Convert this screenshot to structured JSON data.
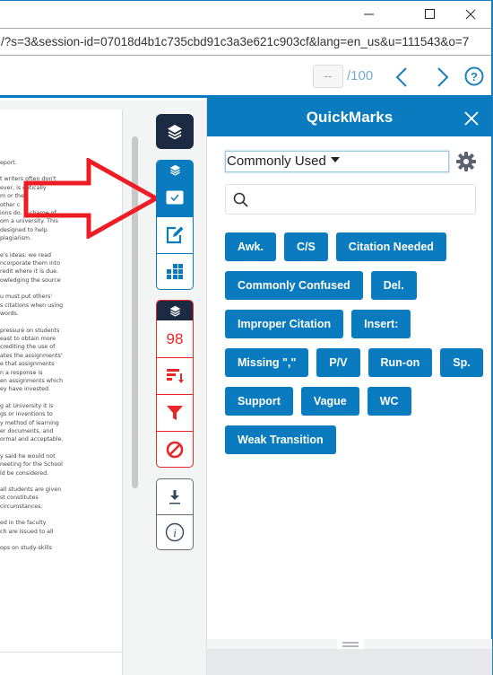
{
  "window": {
    "controls": {
      "minimize": "—",
      "maximize": "☐",
      "close": "✕"
    },
    "url": "/?s=3&session-id=07018d4b1c735cbd91c3a3e621c903cf&lang=en_us&u=111543&o=7"
  },
  "toolbar": {
    "page_input_value": "--",
    "page_total": "/100",
    "prev_icon": "chevron-left-icon",
    "next_icon": "chevron-right-icon",
    "help_icon": "help-circle-icon"
  },
  "document": {
    "paragraphs": [
      [
        "eport."
      ],
      [
        "t writers often don't",
        "ever, is critically",
        "m or the",
        " other c",
        "ions do. A charge of",
        "om a university. This",
        "designed to help",
        " plagiarism."
      ],
      [
        "e's ideas: we read",
        "ncorporate them into",
        "redit where it is due.",
        "owledging the source"
      ],
      [
        "u must put others'",
        "s citations when using",
        "words."
      ],
      [
        "pressure on students",
        "east to obtain more",
        "crediting the use of",
        "ates the assignments'",
        "e that assignments",
        "n a response is",
        "en assignments which",
        "ey have invested."
      ],
      [
        "g at University it is",
        "gs or inventions to",
        "y method of learning",
        "er documents, and",
        "ormal and acceptable."
      ],
      [
        "y said he would not",
        "neeting for the School",
        "ld be considered."
      ],
      [
        "all students are given",
        "st constitutes",
        " circumstances."
      ],
      [
        "ed in the faculty",
        "ch are issued to all"
      ],
      [
        "ops on study-skills"
      ]
    ]
  },
  "sidebar": {
    "top_icon": "layers-icon",
    "blue_group": {
      "header_icon": "layers-icon",
      "items": [
        {
          "name": "quickmarks",
          "icon": "checkbox-icon",
          "active": true
        },
        {
          "name": "comments",
          "icon": "edit-icon",
          "active": false
        },
        {
          "name": "rubric",
          "icon": "grid-icon",
          "active": false
        }
      ]
    },
    "red_group": {
      "header_icon": "layers-icon",
      "similarity_score": "98",
      "items": [
        {
          "name": "match-overview",
          "icon": "sort-bars-icon"
        },
        {
          "name": "filter",
          "icon": "filter-icon"
        },
        {
          "name": "exclusions",
          "icon": "no-entry-icon"
        }
      ]
    },
    "grey_group": {
      "items": [
        {
          "name": "download",
          "icon": "download-icon"
        },
        {
          "name": "info",
          "icon": "info-icon"
        }
      ]
    }
  },
  "quickmarks": {
    "title": "QuickMarks",
    "close_icon": "close-icon",
    "set_selected": "Commonly Used",
    "settings_icon": "gear-icon",
    "search_placeholder": "",
    "tags": [
      "Awk.",
      "C/S",
      "Citation Needed",
      "Commonly Confused",
      "Del.",
      "Improper Citation",
      "Insert:",
      "Missing \",\"",
      "P/V",
      "Run-on",
      "Sp.",
      "Support",
      "Vague",
      "WC",
      "Weak Transition"
    ]
  },
  "colors": {
    "accent_blue": "#0a7bbf",
    "dark_navy": "#1c2a42",
    "similarity_red": "#e8272a",
    "annotation_arrow": "#ee1c24"
  }
}
